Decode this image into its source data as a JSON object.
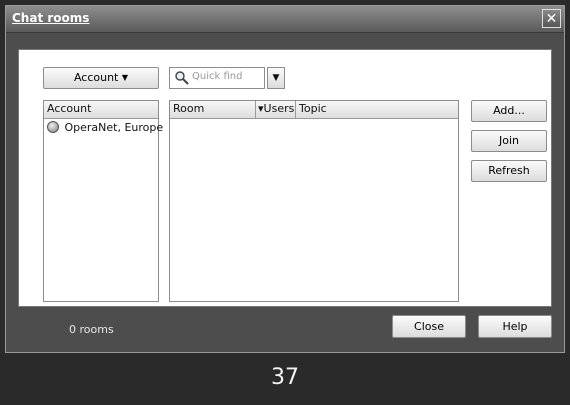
{
  "window": {
    "title": "Chat rooms",
    "close_glyph": "✕"
  },
  "toolbar": {
    "account_label": "Account",
    "account_caret": "▼",
    "search_placeholder": "Quick find",
    "search_icon": "search-icon",
    "dropdown_glyph": "▼"
  },
  "account_list": {
    "header": "Account",
    "items": [
      {
        "icon": "chat-bubble-icon",
        "label": "OperaNet, Europe"
      }
    ]
  },
  "rooms_list": {
    "columns": [
      "Room",
      "Users",
      "Topic"
    ],
    "users_sort_glyph": "▾",
    "rows": []
  },
  "side_buttons": {
    "add": "Add...",
    "join": "Join",
    "refresh": "Refresh"
  },
  "footer": {
    "status": "0 rooms",
    "close": "Close",
    "help": "Help"
  },
  "page_number": "37"
}
